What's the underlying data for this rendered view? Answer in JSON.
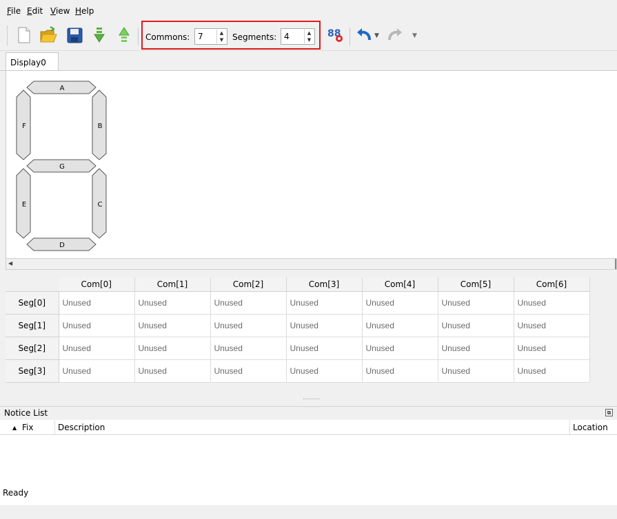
{
  "menu": {
    "items": [
      {
        "accel": "F",
        "rest": "ile"
      },
      {
        "accel": "E",
        "rest": "dit"
      },
      {
        "accel": "V",
        "rest": "iew"
      },
      {
        "accel": "H",
        "rest": "elp"
      }
    ]
  },
  "toolbar": {
    "commons_label": "Commons:",
    "commons_value": "7",
    "segments_label": "Segments:",
    "segments_value": "4",
    "buttons": [
      "new-file-icon",
      "open-folder-icon",
      "save-icon",
      "import-down-icon",
      "export-up-icon",
      "configure-icon",
      "undo-icon",
      "redo-icon"
    ]
  },
  "tabs": {
    "active": "Display0"
  },
  "display": {
    "segments": {
      "a": "A",
      "b": "B",
      "c": "C",
      "d": "D",
      "e": "E",
      "f": "F",
      "g": "G"
    }
  },
  "grid": {
    "columns": [
      "Com[0]",
      "Com[1]",
      "Com[2]",
      "Com[3]",
      "Com[4]",
      "Com[5]",
      "Com[6]"
    ],
    "rows": [
      {
        "label": "Seg[0]",
        "cells": [
          "Unused",
          "Unused",
          "Unused",
          "Unused",
          "Unused",
          "Unused",
          "Unused"
        ]
      },
      {
        "label": "Seg[1]",
        "cells": [
          "Unused",
          "Unused",
          "Unused",
          "Unused",
          "Unused",
          "Unused",
          "Unused"
        ]
      },
      {
        "label": "Seg[2]",
        "cells": [
          "Unused",
          "Unused",
          "Unused",
          "Unused",
          "Unused",
          "Unused",
          "Unused"
        ]
      },
      {
        "label": "Seg[3]",
        "cells": [
          "Unused",
          "Unused",
          "Unused",
          "Unused",
          "Unused",
          "Unused",
          "Unused"
        ]
      }
    ]
  },
  "notice": {
    "title": "Notice List",
    "col_fix": "Fix",
    "col_description": "Description",
    "col_location": "Location"
  },
  "status": {
    "text": "Ready"
  },
  "colors": {
    "highlight": "#e0191b",
    "accent_blue": "#1a73c8"
  }
}
